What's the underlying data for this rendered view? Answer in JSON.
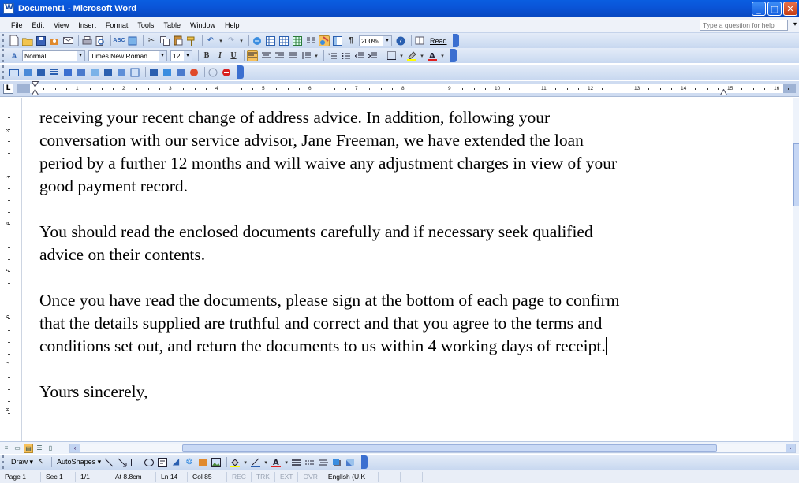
{
  "window": {
    "title": "Document1 - Microsoft Word",
    "minimize": "_",
    "maximize": "□",
    "close": "✕"
  },
  "menu": {
    "items": [
      "File",
      "Edit",
      "View",
      "Insert",
      "Format",
      "Tools",
      "Table",
      "Window",
      "Help"
    ],
    "help_placeholder": "Type a question for help"
  },
  "standard_toolbar": {
    "zoom": "200%",
    "read_label": "Read"
  },
  "formatting_toolbar": {
    "style": "Normal",
    "font": "Times New Roman",
    "size": "12",
    "bold": "B",
    "italic": "I",
    "underline": "U"
  },
  "ruler": {
    "numbers": [
      "1",
      "2",
      "3",
      "4",
      "5",
      "6",
      "7",
      "8",
      "9",
      "10",
      "11",
      "12",
      "13",
      "14",
      "15",
      "16"
    ],
    "tab_selector": "L"
  },
  "vertical_ruler": {
    "numbers": [
      "2",
      "3",
      "4",
      "5",
      "6",
      "7",
      "8"
    ]
  },
  "document": {
    "lines": [
      "receiving your recent change of address advice. In addition, following your",
      "conversation with our service advisor, Jane Freeman, we have extended the loan",
      "period by a further 12 months and will waive any adjustment charges in view of your",
      "good payment record.",
      "You should read the enclosed documents carefully and if necessary seek qualified",
      "advice on their contents.",
      "Once you have read the documents, please sign at the bottom of each page to confirm",
      "that the details supplied are truthful and correct and that you agree to the terms and",
      "conditions set out, and return the documents to us within 4 working days of receipt.",
      "Yours sincerely,"
    ]
  },
  "drawing_toolbar": {
    "draw": "Draw",
    "autoshapes": "AutoShapes"
  },
  "status": {
    "page": "Page 1",
    "section": "Sec 1",
    "pages": "1/1",
    "at": "At 8.8cm",
    "line": "Ln 14",
    "col": "Col 85",
    "rec": "REC",
    "trk": "TRK",
    "ext": "EXT",
    "ovr": "OVR",
    "language": "English (U.K"
  }
}
